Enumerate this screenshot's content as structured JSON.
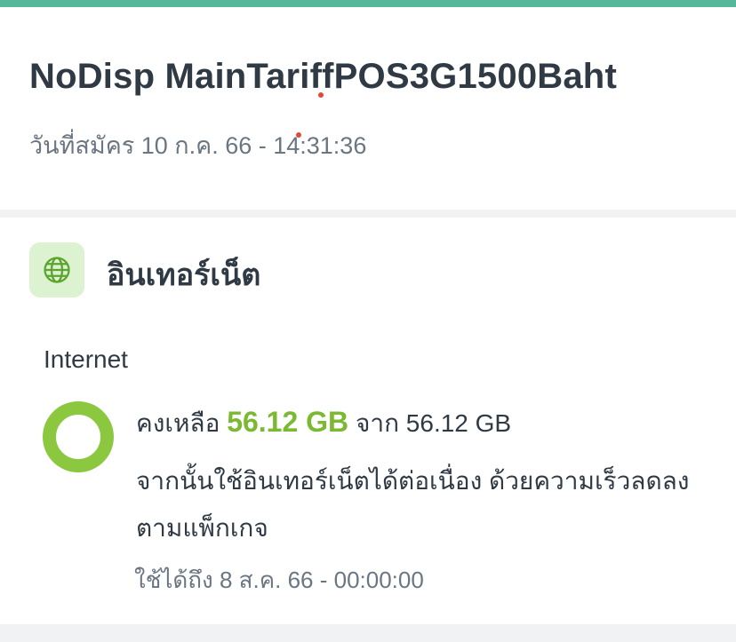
{
  "header": {
    "package_title": "NoDisp MainTariffPOS3G1500Baht",
    "purchase_date": "วันที่สมัคร 10 ก.ค. 66 - 14:31:36"
  },
  "section": {
    "icon": "globe-icon",
    "title": "อินเทอร์เน็ต",
    "quota_label": "Internet",
    "remaining_prefix": "คงเหลือ",
    "remaining_value": "56.12 GB",
    "remaining_suffix": "จาก 56.12 GB",
    "after_quota_note": "จากนั้นใช้อินเทอร์เน็ตได้ต่อเนื่อง ด้วยความเร็วลดลงตามแพ็กเกจ",
    "validity": "ใช้ได้ถึง 8 ส.ค. 66 - 00:00:00",
    "remaining_fraction": 1.0
  },
  "colors": {
    "top_accent": "#55b89a",
    "ring_green": "#8cc83f",
    "value_green": "#7cb932",
    "icon_tile_bg": "#dcf2d0",
    "text_dark": "#2f3a45",
    "text_muted": "#6a7682",
    "divider": "#f1f2f4"
  }
}
